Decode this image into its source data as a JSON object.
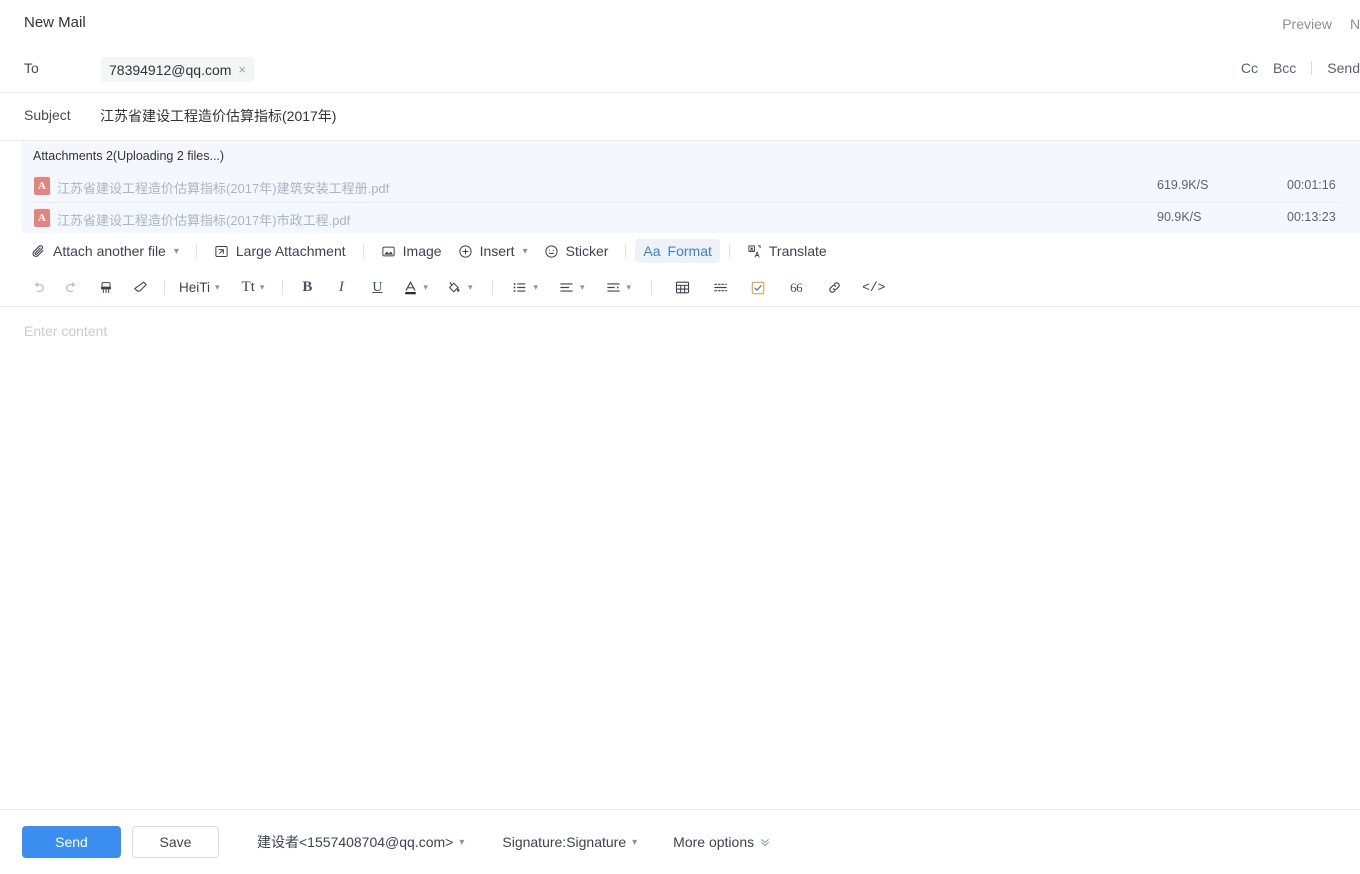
{
  "header": {
    "title": "New Mail",
    "preview_label": "Preview",
    "next_label_truncated": "N"
  },
  "to_row": {
    "label": "To",
    "recipient": "78394912@qq.com",
    "remove_icon": "×",
    "cc_label": "Cc",
    "bcc_label": "Bcc",
    "send_label": "Send"
  },
  "subject_row": {
    "label": "Subject",
    "value": "江苏省建设工程造价估算指标(2017年)"
  },
  "attachments": {
    "title": "Attachments 2(Uploading 2 files...)",
    "panel_color": "#f4f8fe",
    "files": [
      {
        "name": "江苏省建设工程造价估算指标(2017年)建筑安装工程册.pdf",
        "type_badge": "A",
        "speed": "619.9K/S",
        "time_remaining": "00:01:16"
      },
      {
        "name": "江苏省建设工程造价估算指标(2017年)市政工程.pdf",
        "type_badge": "A",
        "speed": "90.9K/S",
        "time_remaining": "00:13:23"
      }
    ]
  },
  "attach_toolbar": {
    "attach_file": "Attach another file",
    "large_attachment": "Large Attachment",
    "image": "Image",
    "insert": "Insert",
    "sticker": "Sticker",
    "format": "Format",
    "format_prefix": "Aa",
    "format_active_color": "#3a7fe0",
    "translate": "Translate"
  },
  "format_toolbar": {
    "undo": "undo-icon",
    "redo": "redo-icon",
    "format_painter": "format-painter-icon",
    "clear_format": "eraser-icon",
    "font_family": "HeiTi",
    "font_size": "Tt",
    "bold": "B",
    "italic": "I",
    "underline": "U",
    "font_color": "A",
    "highlight": "highlight-icon",
    "bullet_list": "bullet-list-icon",
    "align": "align-icon",
    "indent": "indent-icon",
    "table": "table-icon",
    "divider": "horizontal-rule-icon",
    "checkbox": "checkbox-icon",
    "quote": "66",
    "link": "link-icon",
    "code": "</>"
  },
  "body": {
    "placeholder": "Enter content"
  },
  "bottom_bar": {
    "send": "Send",
    "save": "Save",
    "sender": "建设者<1557408704@qq.com>",
    "signature": "Signature:Signature",
    "more_options": "More options",
    "send_color": "#3a8ef0"
  }
}
